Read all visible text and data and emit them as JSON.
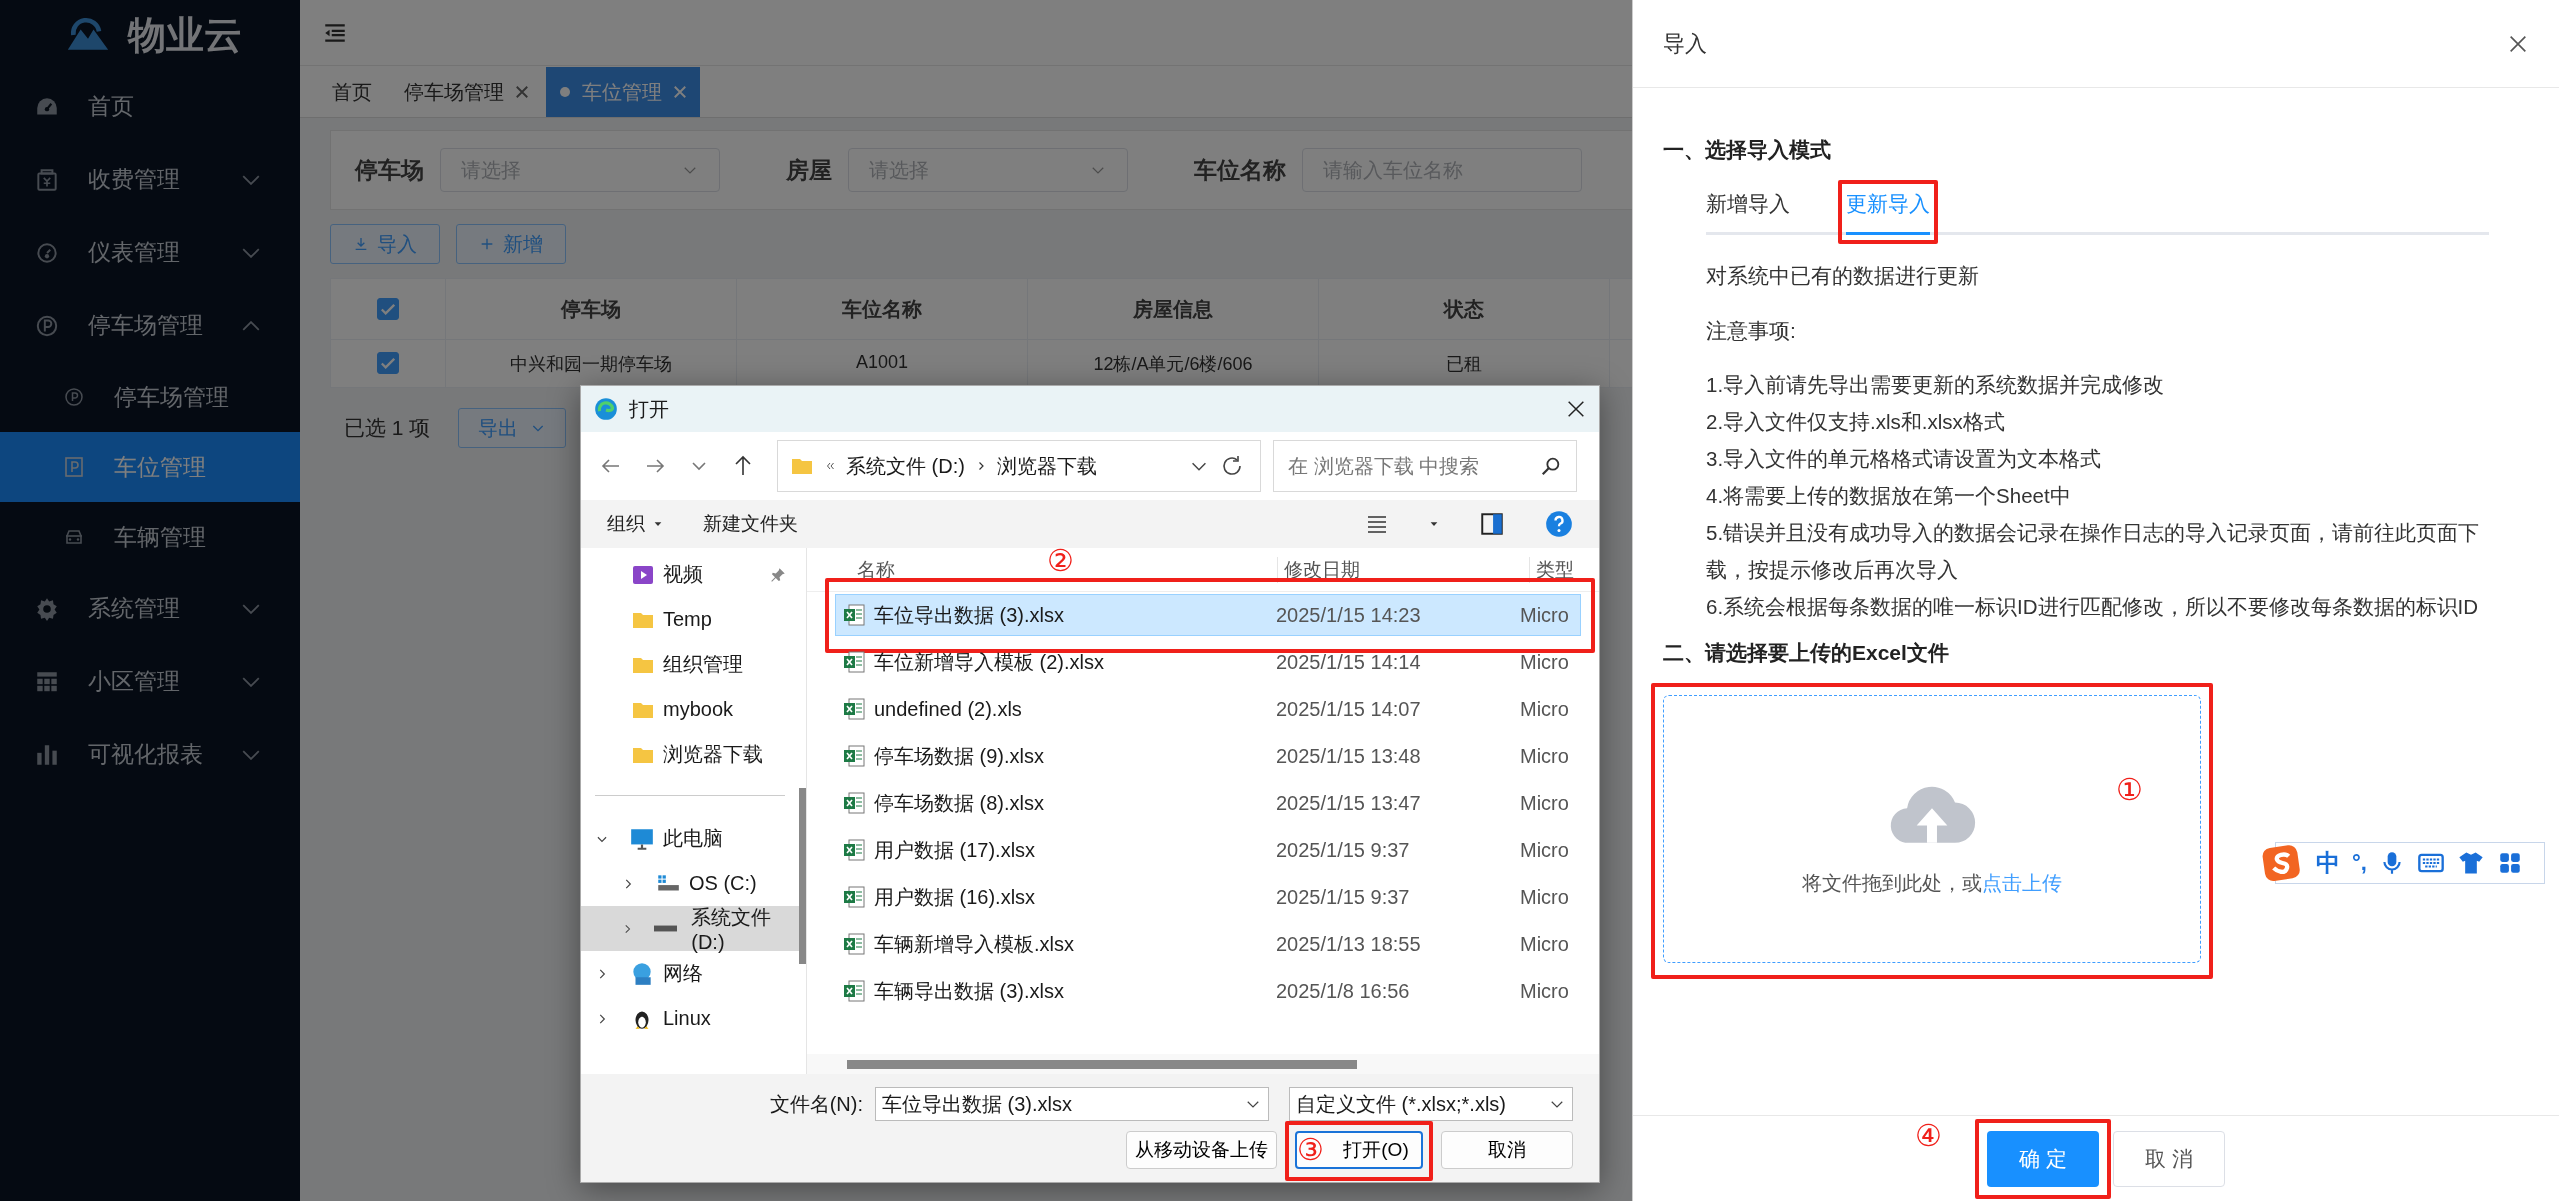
{
  "sidebar": {
    "logo": "物业云",
    "items": [
      {
        "label": "首页",
        "kind": "link"
      },
      {
        "label": "收费管理",
        "kind": "group",
        "expanded": false
      },
      {
        "label": "仪表管理",
        "kind": "group",
        "expanded": false
      },
      {
        "label": "停车场管理",
        "kind": "group",
        "expanded": true,
        "children": [
          {
            "label": "停车场管理",
            "selected": false
          },
          {
            "label": "车位管理",
            "selected": true
          },
          {
            "label": "车辆管理",
            "selected": false
          }
        ]
      },
      {
        "label": "系统管理",
        "kind": "group",
        "expanded": false
      },
      {
        "label": "小区管理",
        "kind": "group",
        "expanded": false
      },
      {
        "label": "可视化报表",
        "kind": "group",
        "expanded": false
      }
    ]
  },
  "tabs": [
    {
      "label": "首页",
      "selected": false,
      "closable": false
    },
    {
      "label": "停车场管理",
      "selected": false,
      "closable": true
    },
    {
      "label": "车位管理",
      "selected": true,
      "closable": true
    }
  ],
  "filters": [
    {
      "label": "停车场",
      "placeholder": "请选择",
      "kind": "select"
    },
    {
      "label": "房屋",
      "placeholder": "请选择",
      "kind": "select"
    },
    {
      "label": "车位名称",
      "placeholder": "请输入车位名称",
      "kind": "input"
    }
  ],
  "actions": [
    {
      "label": "导入"
    },
    {
      "label": "新增"
    }
  ],
  "table": {
    "header_checked": true,
    "columns": [
      "停车场",
      "车位名称",
      "房屋信息",
      "状态"
    ],
    "rows": [
      {
        "checked": true,
        "cells": [
          "中兴和园一期停车场",
          "A1001",
          "12栋/A单元/6楼/606",
          "已租"
        ]
      }
    ]
  },
  "footer": {
    "selection": "已选 1 项",
    "export": "导出"
  },
  "file_dialog": {
    "title": "打开",
    "path": [
      "系统文件 (D:)",
      "浏览器下载"
    ],
    "search_placeholder": "在 浏览器下载 中搜索",
    "toolbar": [
      "组织",
      "新建文件夹"
    ],
    "quick_access": [
      {
        "label": "视频",
        "pinned": true
      },
      {
        "label": "Temp",
        "pinned": false
      },
      {
        "label": "组织管理",
        "pinned": false
      },
      {
        "label": "mybook",
        "pinned": false
      },
      {
        "label": "浏览器下载",
        "pinned": false
      }
    ],
    "tree": [
      {
        "label": "此电脑",
        "expanded": true,
        "selected": false,
        "children": [
          {
            "label": "OS (C:)",
            "expanded": false,
            "selected": false
          },
          {
            "label": "系统文件 (D:)",
            "expanded": false,
            "selected": true
          }
        ]
      },
      {
        "label": "网络",
        "expanded": false,
        "selected": false
      },
      {
        "label": "Linux",
        "expanded": false,
        "selected": false
      }
    ],
    "columns": [
      "名称",
      "修改日期",
      "类型"
    ],
    "files": [
      {
        "name": "车位导出数据 (3).xlsx",
        "date": "2025/1/15 14:23",
        "type": "Micro",
        "selected": true,
        "highlighted": true,
        "callout": "②"
      },
      {
        "name": "车位新增导入模板 (2).xlsx",
        "date": "2025/1/15 14:14",
        "type": "Micro",
        "selected": false,
        "highlighted": false
      },
      {
        "name": "undefined (2).xls",
        "date": "2025/1/15 14:07",
        "type": "Micro",
        "selected": false,
        "highlighted": false
      },
      {
        "name": "停车场数据 (9).xlsx",
        "date": "2025/1/15 13:48",
        "type": "Micro",
        "selected": false,
        "highlighted": false
      },
      {
        "name": "停车场数据 (8).xlsx",
        "date": "2025/1/15 13:47",
        "type": "Micro",
        "selected": false,
        "highlighted": false
      },
      {
        "name": "用户数据 (17).xlsx",
        "date": "2025/1/15 9:37",
        "type": "Micro",
        "selected": false,
        "highlighted": false
      },
      {
        "name": "用户数据 (16).xlsx",
        "date": "2025/1/15 9:37",
        "type": "Micro",
        "selected": false,
        "highlighted": false
      },
      {
        "name": "车辆新增导入模板.xlsx",
        "date": "2025/1/13 18:55",
        "type": "Micro",
        "selected": false,
        "highlighted": false
      },
      {
        "name": "车辆导出数据 (3).xlsx",
        "date": "2025/1/8 16:56",
        "type": "Micro",
        "selected": false,
        "highlighted": false
      }
    ],
    "filename_label": "文件名(N):",
    "filename": "车位导出数据 (3).xlsx",
    "file_type": "自定义文件 (*.xlsx;*.xls)",
    "buttons": [
      {
        "label": "从移动设备上传",
        "kind": "default",
        "highlighted": false
      },
      {
        "label": "打开(O)",
        "kind": "primary",
        "highlighted": true,
        "callout": "③"
      },
      {
        "label": "取消",
        "kind": "default",
        "highlighted": false
      }
    ]
  },
  "drawer": {
    "title": "导入",
    "section_1": "一、选择导入模式",
    "tabs": [
      {
        "label": "新增导入",
        "selected": false,
        "highlighted": false
      },
      {
        "label": "更新导入",
        "selected": true,
        "highlighted": true
      }
    ],
    "description": "对系统中已有的数据进行更新",
    "notes_title": "注意事项:",
    "notes": [
      "1.导入前请先导出需要更新的系统数据并完成修改",
      "2.导入文件仅支持.xls和.xlsx格式",
      "3.导入文件的单元格格式请设置为文本格式",
      "4.将需要上传的数据放在第一个Sheet中",
      "5.错误并且没有成功导入的数据会记录在操作日志的导入记录页面，请前往此页面下载，按提示修改后再次导入",
      "6.系统会根据每条数据的唯一标识ID进行匹配修改，所以不要修改每条数据的标识ID"
    ],
    "section_2": "二、请选择要上传的Excel文件",
    "upload": {
      "text": "将文件拖到此处，或",
      "link": "点击上传",
      "highlighted": true,
      "callout": "①"
    },
    "buttons": [
      {
        "label": "确 定",
        "kind": "primary",
        "highlighted": true,
        "callout": "④"
      },
      {
        "label": "取 消",
        "kind": "default",
        "highlighted": false
      }
    ]
  },
  "ime_toolbar": {
    "mode": "中",
    "punctuation": "°,"
  }
}
